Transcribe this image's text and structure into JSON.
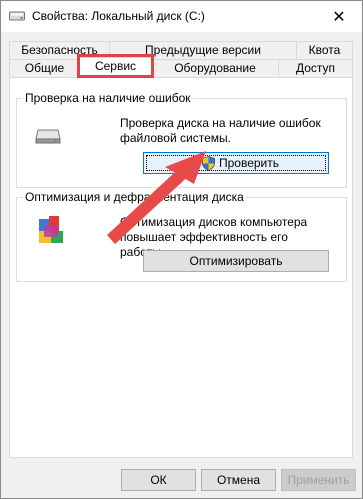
{
  "window": {
    "title": "Свойства: Локальный диск (C:)",
    "close_glyph": "✕"
  },
  "tabs": {
    "row1": [
      "Безопасность",
      "Предыдущие версии",
      "Квота"
    ],
    "row2": [
      "Общие",
      "Сервис",
      "Оборудование",
      "Доступ"
    ],
    "active": "Сервис"
  },
  "check_group": {
    "title": "Проверка на наличие ошибок",
    "description": "Проверка диска на наличие ошибок файловой системы.",
    "button_label": "Проверить"
  },
  "optimize_group": {
    "title": "Оптимизация и дефрагментация диска",
    "description": "Оптимизация дисков компьютера повышает эффективность его работы.",
    "button_label": "Оптимизировать"
  },
  "footer": {
    "ok_label": "ОК",
    "cancel_label": "Отмена",
    "apply_label": "Применить"
  },
  "colors": {
    "highlight": "#e04444",
    "arrow": "#e84a4a",
    "focus_border": "#0078d7"
  }
}
